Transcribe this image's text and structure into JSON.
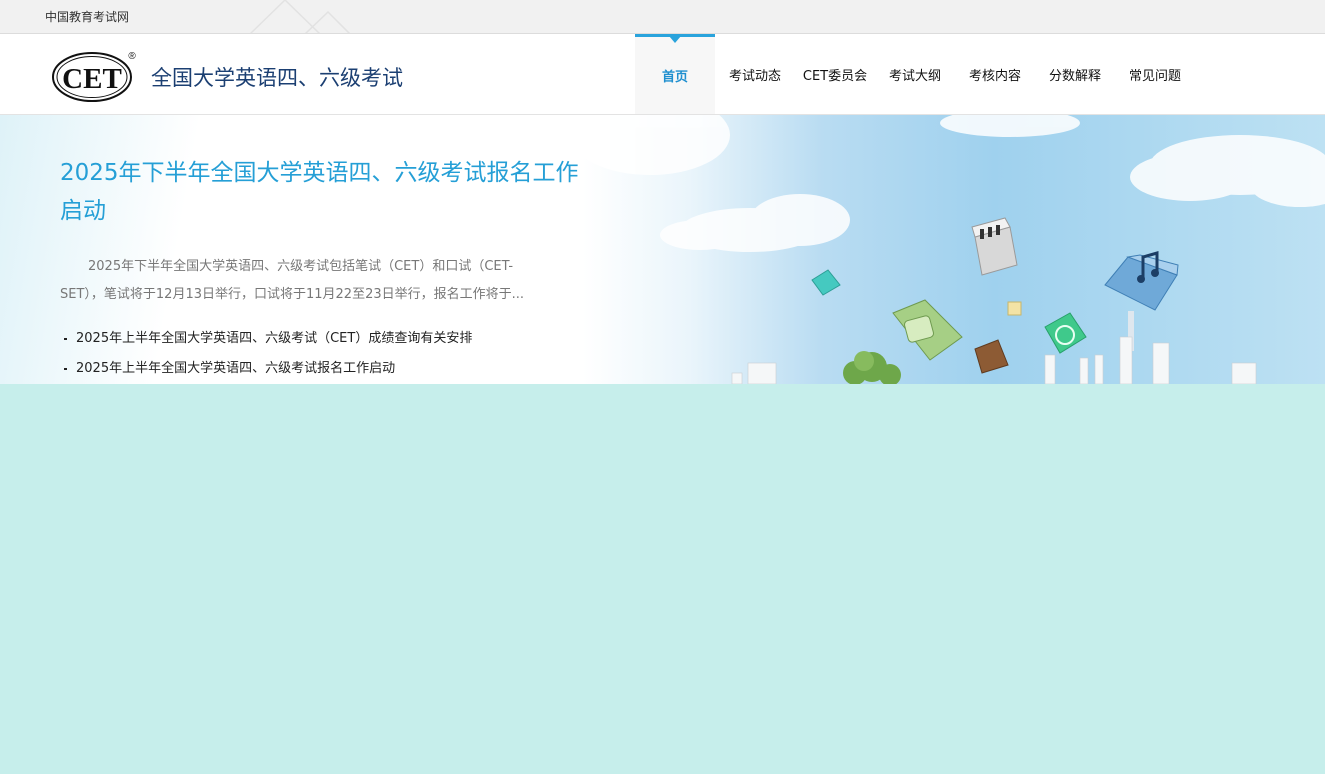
{
  "topbar": {
    "site_link": "中国教育考试网"
  },
  "header": {
    "logo_text": "CET",
    "registered_mark": "®",
    "site_title": "全国大学英语四、六级考试"
  },
  "nav": {
    "items": [
      {
        "label": "首页",
        "active": true
      },
      {
        "label": "考试动态",
        "active": false
      },
      {
        "label": "CET委员会",
        "active": false
      },
      {
        "label": "考试大纲",
        "active": false
      },
      {
        "label": "考核内容",
        "active": false
      },
      {
        "label": "分数解释",
        "active": false
      },
      {
        "label": "常见问题",
        "active": false
      }
    ]
  },
  "banner": {
    "headline": "2025年下半年全国大学英语四、六级考试报名工作启动",
    "summary": "2025年下半年全国大学英语四、六级考试包括笔试（CET）和口试（CET-SET），笔试将于12月13日举行，口试将于11月22至23日举行，报名工作将于...",
    "news": [
      "2025年上半年全国大学英语四、六级考试（CET）成绩查询有关安排",
      "2025年上半年全国大学英语四、六级考试报名工作启动"
    ]
  },
  "colors": {
    "accent": "#29a3dc",
    "headline": "#259fd6",
    "title": "#1b3f72",
    "page_bg": "#c6eeeb"
  }
}
